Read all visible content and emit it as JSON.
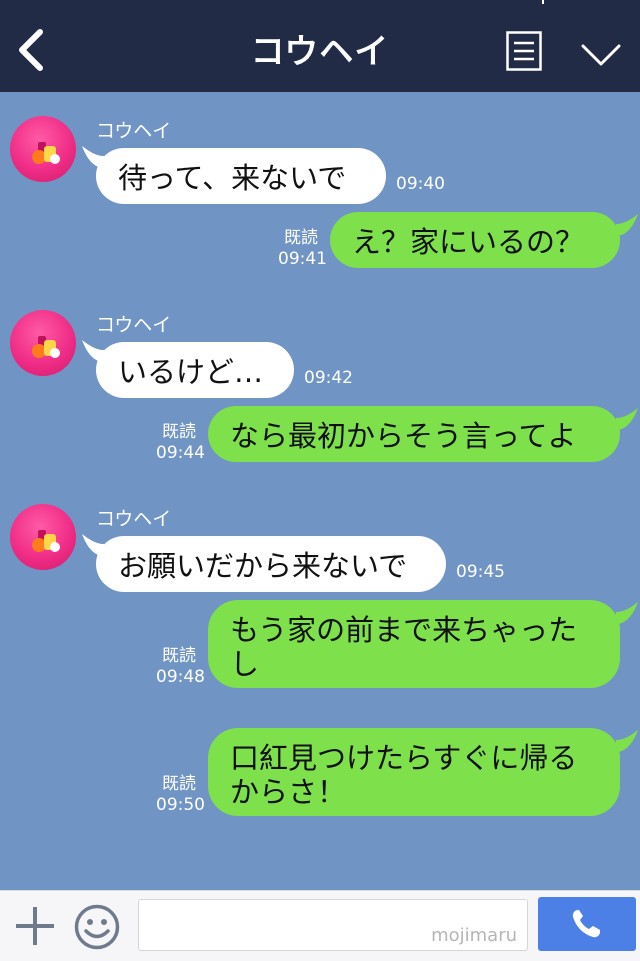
{
  "header": {
    "title": "コウヘイ"
  },
  "contact": {
    "name": "コウヘイ"
  },
  "messages": [
    {
      "side": "in",
      "sender": "コウヘイ",
      "text": "待って、来ないで",
      "time": "09:40"
    },
    {
      "side": "out",
      "status": "既読",
      "text": "え？家にいるの？",
      "time": "09:41"
    },
    {
      "side": "in",
      "sender": "コウヘイ",
      "text": "いるけど…",
      "time": "09:42"
    },
    {
      "side": "out",
      "status": "既読",
      "text": "なら最初からそう言ってよ",
      "time": "09:44"
    },
    {
      "side": "in",
      "sender": "コウヘイ",
      "text": "お願いだから来ないで",
      "time": "09:45"
    },
    {
      "side": "out",
      "status": "既読",
      "text": "もう家の前まで来ちゃったし",
      "time": "09:48"
    },
    {
      "side": "out",
      "status": "既読",
      "text": "口紅見つけたらすぐに帰るからさ！",
      "time": "09:50"
    }
  ],
  "footer": {
    "input_value": "",
    "watermark": "mojimaru"
  },
  "icons": {
    "back": "chevron-left-icon",
    "menu": "menu-list-icon",
    "collapse": "chevron-down-icon",
    "add": "plus-icon",
    "emoji": "smile-icon",
    "call": "phone-icon"
  },
  "colors": {
    "header_bg": "#222b45",
    "chat_bg": "#7094c4",
    "incoming_bubble": "#ffffff",
    "outgoing_bubble": "#7ee04b",
    "call_button": "#4d80e6"
  }
}
